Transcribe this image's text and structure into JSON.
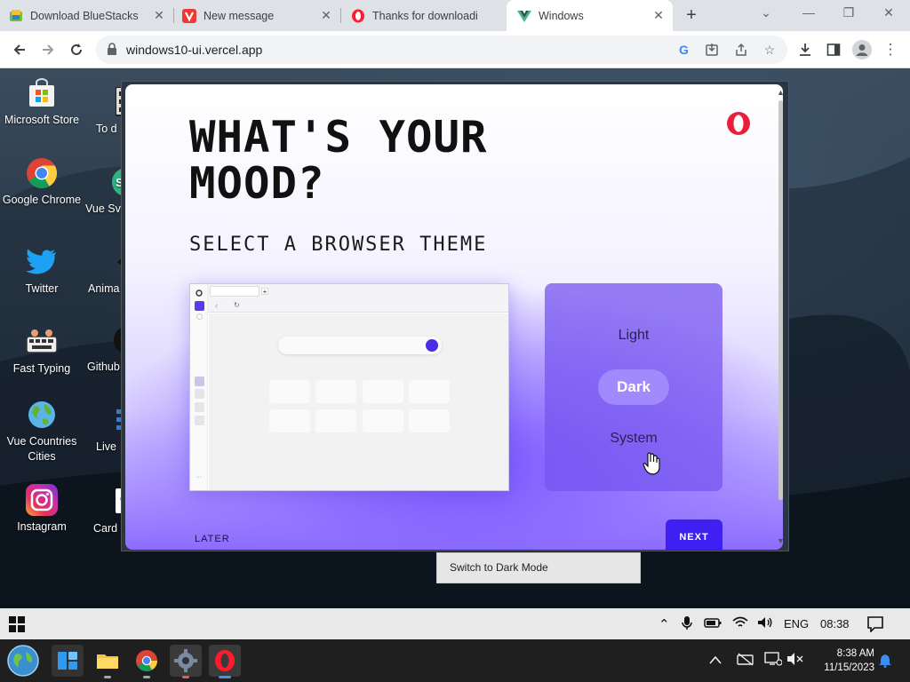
{
  "browser": {
    "tabs": [
      {
        "title": "Download BlueStacks",
        "icon": "bluestacks-icon"
      },
      {
        "title": "New message",
        "icon": "vivaldi-mail-icon"
      },
      {
        "title": "Thanks for downloadi",
        "icon": "opera-icon"
      },
      {
        "title": "Windows",
        "icon": "vue-icon",
        "active": true
      }
    ],
    "url": "windows10-ui.vercel.app"
  },
  "desktop": {
    "icons": [
      {
        "label": "Microsoft Store",
        "icon": "store-icon"
      },
      {
        "label": "Google Chrome",
        "icon": "chrome-icon"
      },
      {
        "label": "Twitter",
        "icon": "twitter-icon"
      },
      {
        "label": "Fast Typing",
        "icon": "keyboard-icon"
      },
      {
        "label": "Vue Countries Cities",
        "icon": "globe-icon"
      },
      {
        "label": "Instagram",
        "icon": "instagram-icon"
      },
      {
        "label": "To d",
        "icon": "todo-icon"
      },
      {
        "label": "Vue Sv",
        "icon": "vue-sv-icon"
      },
      {
        "label": "Anima",
        "icon": "animation-icon"
      },
      {
        "label": "Github",
        "icon": "github-icon"
      },
      {
        "label": "Live",
        "icon": "live-icon"
      },
      {
        "label": "Card",
        "icon": "card-icon"
      }
    ]
  },
  "opera": {
    "headline_line1": "WHAT'S YOUR",
    "headline_line2": "MOOD?",
    "subheading": "SELECT A BROWSER THEME",
    "themes": {
      "light": "Light",
      "dark": "Dark",
      "system": "System"
    },
    "later": "LATER",
    "next": "NEXT",
    "accent": "#3f1ff2"
  },
  "tooltip": "Switch to Dark Mode",
  "taskbar_top": {
    "language": "ENG",
    "time": "08:38"
  },
  "taskbar_bottom": {
    "time": "8:38 AM",
    "date": "11/15/2023"
  }
}
